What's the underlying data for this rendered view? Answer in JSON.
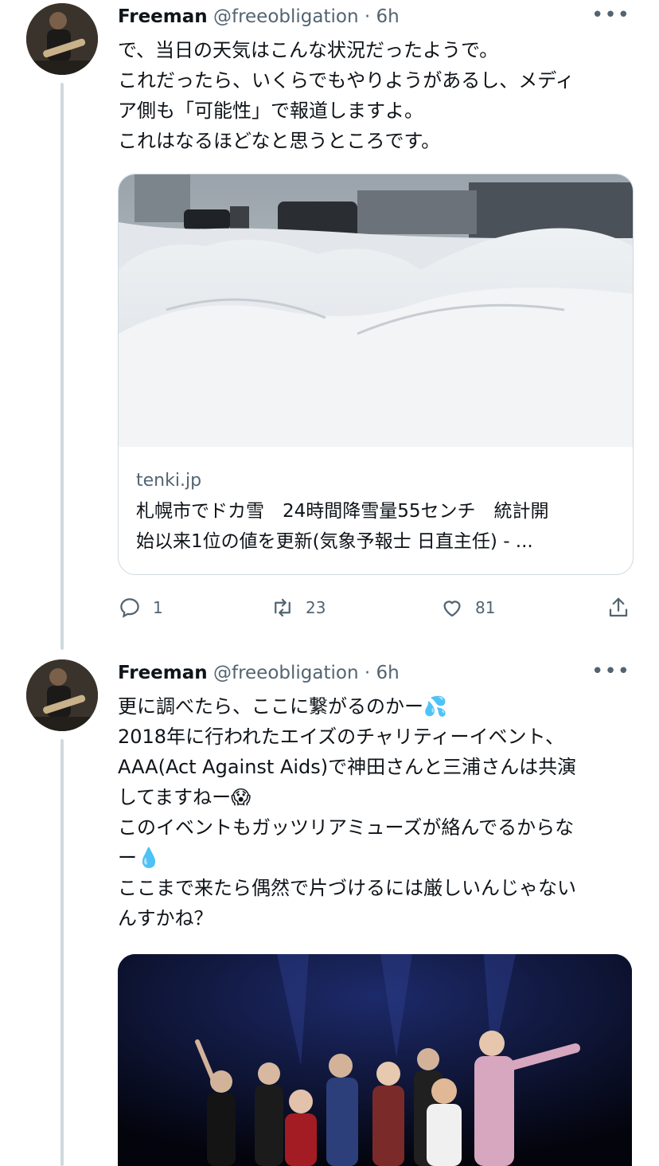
{
  "tweets": [
    {
      "author": {
        "name": "Freeman",
        "handle": "@freeobligation",
        "separator": "·",
        "time": "6h"
      },
      "more_icon": "more-horizontal-icon",
      "text_lines": [
        "で、当日の天気はこんな状況だったようで。",
        "これだったら、いくらでもやりようがあるし、メディ",
        "ア側も「可能性」で報道しますよ。",
        "これはなるほどなと思うところです。"
      ],
      "card": {
        "domain": "tenki.jp",
        "title_lines": [
          "札幌市でドカ雪　24時間降雪量55センチ　統計開",
          "始以来1位の値を更新(気象予報士 日直主任) - ..."
        ]
      },
      "actions": {
        "reply": {
          "icon": "reply-icon",
          "count": "1"
        },
        "retweet": {
          "icon": "retweet-icon",
          "count": "23"
        },
        "like": {
          "icon": "heart-icon",
          "count": "81"
        },
        "share": {
          "icon": "share-icon"
        }
      }
    },
    {
      "author": {
        "name": "Freeman",
        "handle": "@freeobligation",
        "separator": "·",
        "time": "6h"
      },
      "more_icon": "more-horizontal-icon",
      "text_lines": [
        {
          "text": "更に調べたら、ここに繋がるのかー",
          "emoji": "💦"
        },
        {
          "text": "2018年に行われたエイズのチャリティーイベント、"
        },
        {
          "text": "AAA(Act Against Aids)で神田さんと三浦さんは共演"
        },
        {
          "text": "してますねー",
          "emoji": "😱"
        },
        {
          "text": "このイベントもガッツリアミューズが絡んでるからな"
        },
        {
          "text": "ー",
          "emoji": "💧"
        },
        {
          "text": "ここまで来たら偶然で片づけるには厳しいんじゃない"
        },
        {
          "text": "んすかね？"
        }
      ]
    }
  ],
  "colors": {
    "text": "#0f1419",
    "secondary": "#536471",
    "border": "#cfd9de"
  }
}
